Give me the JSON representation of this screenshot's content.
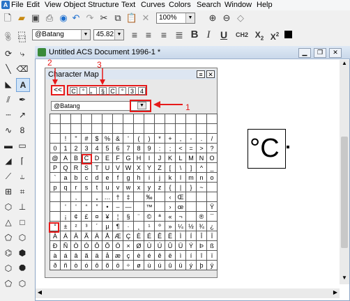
{
  "menubar": {
    "items": [
      "File",
      "Edit",
      "View",
      "Object",
      "Structure",
      "Text",
      "Curves",
      "Colors",
      "Search",
      "Window",
      "Help"
    ]
  },
  "toolbar": {
    "zoom": "100%",
    "font": "@Batang",
    "font_size": "45.82",
    "sub_label": "CH2",
    "subscript_label": "X2",
    "superscript_label": "X2"
  },
  "document": {
    "title": "Untitled ACS Document 1996-1 *",
    "symbol": "°C"
  },
  "charmap": {
    "title": "Character Map",
    "back_button": "<<",
    "recent": [
      "C",
      "°",
      "。",
      "§",
      "C",
      "°",
      "3",
      "4"
    ],
    "font": "@Batang",
    "rows": [
      [
        "",
        "",
        "",
        "",
        "",
        "",
        "",
        "",
        "",
        "",
        "",
        "",
        "",
        "",
        "",
        ""
      ],
      [
        "",
        "",
        "",
        "",
        "",
        "",
        "",
        "",
        "",
        "",
        "",
        "",
        "",
        "",
        "",
        ""
      ],
      [
        "",
        "!",
        "\"",
        "#",
        "$",
        "%",
        "&",
        "'",
        "(",
        ")",
        "*",
        "+",
        ",",
        "-",
        ".",
        "/"
      ],
      [
        "0",
        "1",
        "2",
        "3",
        "4",
        "5",
        "6",
        "7",
        "8",
        "9",
        ":",
        ";",
        "<",
        "=",
        ">",
        "?"
      ],
      [
        "@",
        "A",
        "B",
        "C",
        "D",
        "E",
        "F",
        "G",
        "H",
        "I",
        "J",
        "K",
        "L",
        "M",
        "N",
        "O"
      ],
      [
        "P",
        "Q",
        "R",
        "S",
        "T",
        "U",
        "V",
        "W",
        "X",
        "Y",
        "Z",
        "[",
        "\\",
        "]",
        "^",
        "_"
      ],
      [
        "`",
        "a",
        "b",
        "c",
        "d",
        "e",
        "f",
        "g",
        "h",
        "i",
        "j",
        "k",
        "l",
        "m",
        "n",
        "o"
      ],
      [
        "p",
        "q",
        "r",
        "s",
        "t",
        "u",
        "v",
        "w",
        "x",
        "y",
        "z",
        "{",
        "|",
        "}",
        "~",
        ""
      ],
      [
        "",
        "",
        "‚",
        "",
        "„",
        "…",
        "†",
        "‡",
        "",
        "‰",
        "",
        "‹",
        "Œ",
        "",
        "",
        ""
      ],
      [
        "",
        "'",
        "'",
        "“",
        "”",
        "•",
        "–",
        "—",
        "",
        "™",
        "",
        "›",
        "œ",
        "",
        "",
        "Ÿ"
      ],
      [
        "",
        "¡",
        "¢",
        "£",
        "¤",
        "¥",
        "¦",
        "§",
        "¨",
        "©",
        "ª",
        "«",
        "¬",
        "",
        "®",
        "¯"
      ],
      [
        "°",
        "±",
        "²",
        "³",
        "´",
        "µ",
        "¶",
        "·",
        "¸",
        "¹",
        "º",
        "»",
        "¼",
        "½",
        "¾",
        "¿"
      ],
      [
        "À",
        "Á",
        "Â",
        "Ã",
        "Ä",
        "Å",
        "Æ",
        "Ç",
        "È",
        "É",
        "Ê",
        "Ë",
        "Ì",
        "Í",
        "Î",
        "Ï"
      ],
      [
        "Ð",
        "Ñ",
        "Ò",
        "Ó",
        "Ô",
        "Õ",
        "Ö",
        "×",
        "Ø",
        "Ù",
        "Ú",
        "Û",
        "Ü",
        "Ý",
        "Þ",
        "ß"
      ],
      [
        "à",
        "á",
        "â",
        "ã",
        "ä",
        "å",
        "æ",
        "ç",
        "è",
        "é",
        "ê",
        "ë",
        "ì",
        "í",
        "î",
        "ï"
      ],
      [
        "ð",
        "ñ",
        "ò",
        "ó",
        "ô",
        "õ",
        "ö",
        "÷",
        "ø",
        "ù",
        "ú",
        "û",
        "ü",
        "ý",
        "þ",
        "ÿ"
      ]
    ]
  },
  "annotations": {
    "label1": "1",
    "label2": "2",
    "label3": "3",
    "color": "#e61919"
  }
}
